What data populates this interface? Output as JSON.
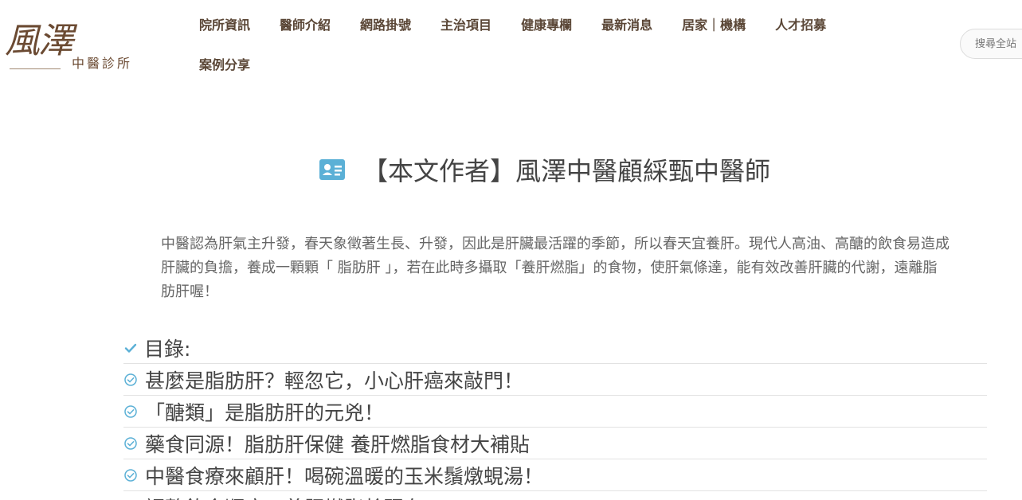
{
  "logo": {
    "main": "風澤",
    "sub": "中醫診所"
  },
  "nav": {
    "row1": [
      "院所資訊",
      "醫師介紹",
      "網路掛號",
      "主治項目",
      "健康專欄",
      "最新消息",
      "居家｜機構",
      "人才招募"
    ],
    "row2": [
      "案例分享"
    ]
  },
  "search": {
    "placeholder": "搜尋全站"
  },
  "author": {
    "heading": "【本文作者】風澤中醫顧綵甄中醫師",
    "icon": "id-card-icon"
  },
  "intro": "中醫認為肝氣主升發，春天象徵著生長、升發，因此是肝臟最活躍的季節，所以春天宜養肝。現代人高油、高醣的飲食易造成肝臟的負擔，養成一顆顆「 脂肪肝 」，若在此時多攝取「養肝燃脂」的食物，使肝氣條達，能有效改善肝臟的代謝，遠離脂肪肝喔！",
  "toc": {
    "heading": "目錄:",
    "items": [
      "甚麼是脂肪肝？輕忽它，小心肝癌來敲門！",
      "「醣類」是脂肪肝的元兇！",
      "藥食同源！脂肪肝保健 養肝燃脂食材大補貼",
      "中醫食療來顧肝！喝碗溫暖的玉米鬚燉蜆湯！",
      "調整飲食順序，養肝燃脂趁現在!"
    ]
  },
  "colors": {
    "brand": "#6b4a32",
    "accent": "#5bb0d6",
    "nav": "#5a4636"
  }
}
